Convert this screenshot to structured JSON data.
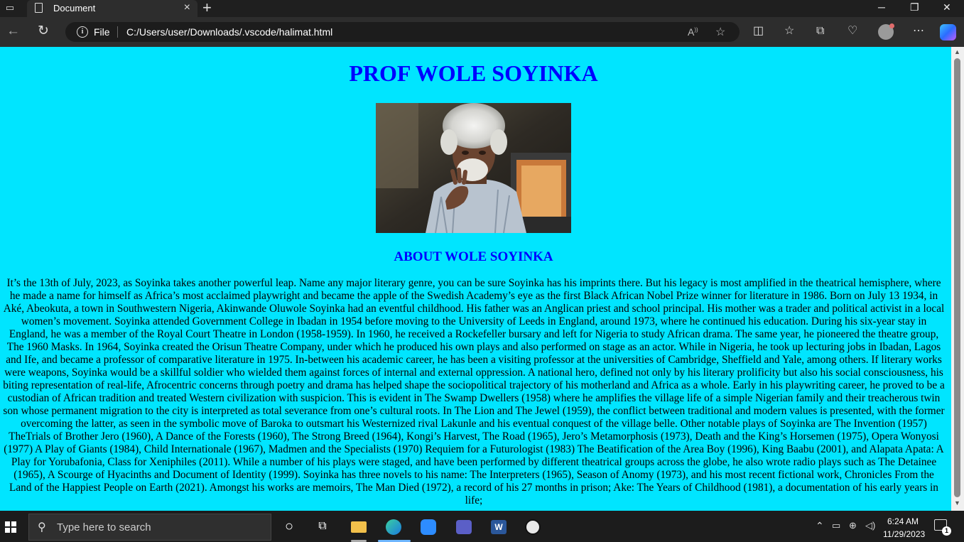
{
  "browser": {
    "tab_title": "Document",
    "new_tab_symbol": "+",
    "address_scheme": "File",
    "url": "C:/Users/user/Downloads/.vscode/halimat.html",
    "window_controls": {
      "minimize": "─",
      "restore": "❐",
      "close": "✕"
    }
  },
  "page": {
    "title": "PROF WOLE SOYINKA",
    "about_heading": "ABOUT WOLE SOYINKA",
    "background_color": "#00e5ff",
    "heading_color": "#0000ff",
    "bio": "It’s the 13th of July, 2023, as Soyinka takes another powerful leap. Name any major literary genre, you can be sure Soyinka has his imprints there. But his legacy is most amplified in the theatrical hemisphere, where he made a name for himself as Africa’s most acclaimed playwright and became the apple of the Swedish Academy’s eye as the first Black African Nobel Prize winner for literature in 1986. Born on July 13 1934, in Aké, Abeokuta, a town in Southwestern Nigeria, Akinwande Oluwole Soyinka had an eventful childhood. His father was an Anglican priest and school principal. His mother was a trader and political activist in a local women’s movement. Soyinka attended Government College in Ibadan in 1954 before moving to the University of Leeds in England, around 1973, where he continued his education. During his six-year stay in England, he was a member of the Royal Court Theatre in London (1958-1959). In 1960, he received a Rockefeller bursary and left for Nigeria to study African drama. The same year, he pioneered the theatre group, The 1960 Masks. In 1964, Soyinka created the Orisun Theatre Company, under which he produced his own plays and also performed on stage as an actor. While in Nigeria, he took up lecturing jobs in Ibadan, Lagos and Ife, and became a professor of comparative literature in 1975. In-between his academic career, he has been a visiting professor at the universities of Cambridge, Sheffield and Yale, among others. If literary works were weapons, Soyinka would be a skillful soldier who wielded them against forces of internal and external oppression. A national hero, defined not only by his literary prolificity but also his social consciousness, his biting representation of real-life, Afrocentric concerns through poetry and drama has helped shape the sociopolitical trajectory of his motherland and Africa as a whole. Early in his playwriting career, he proved to be a custodian of African tradition and treated Western civilization with suspicion. This is evident in The Swamp Dwellers (1958) where he amplifies the village life of a simple Nigerian family and their treacherous twin son whose permanent migration to the city is interpreted as total severance from one’s cultural roots. In The Lion and The Jewel (1959), the conflict between traditional and modern values is presented, with the former overcoming the latter, as seen in the symbolic move of Baroka to outsmart his Westernized rival Lakunle and his eventual conquest of the village belle. Other notable plays of Soyinka are The Invention (1957) TheTrials of Brother Jero (1960), A Dance of the Forests (1960), The Strong Breed (1964), Kongi’s Harvest, The Road (1965), Jero’s Metamorphosis (1973), Death and the King’s Horsemen (1975), Opera Wonyosi (1977) A Play of Giants (1984), Child Internationale (1967), Madmen and the Specialists (1970) Requiem for a Futurologist (1983) The Beatification of the Area Boy (1996), King Baabu (2001), and Alapata Apata: A Play for Yorubafonia, Class for Xeniphiles (2011). While a number of his plays were staged, and have been performed by different theatrical groups across the globe, he also wrote radio plays such as The Detainee (1965), A Scourge of Hyacinths and Document of Identity (1999). Soyinka has three novels to his name: The Interpreters (1965), Season of Anomy (1973), and his most recent fictional work, Chronicles From the Land of the Happiest People on Earth (2021). Amongst his works are memoirs, The Man Died (1972), a record of his 27 months in prison; Ake: The Years of Childhood (1981), a documentation of his early years in life;"
  },
  "taskbar": {
    "search_placeholder": "Type here to search",
    "time": "6:24 AM",
    "date": "11/29/2023",
    "notification_count": "1"
  }
}
